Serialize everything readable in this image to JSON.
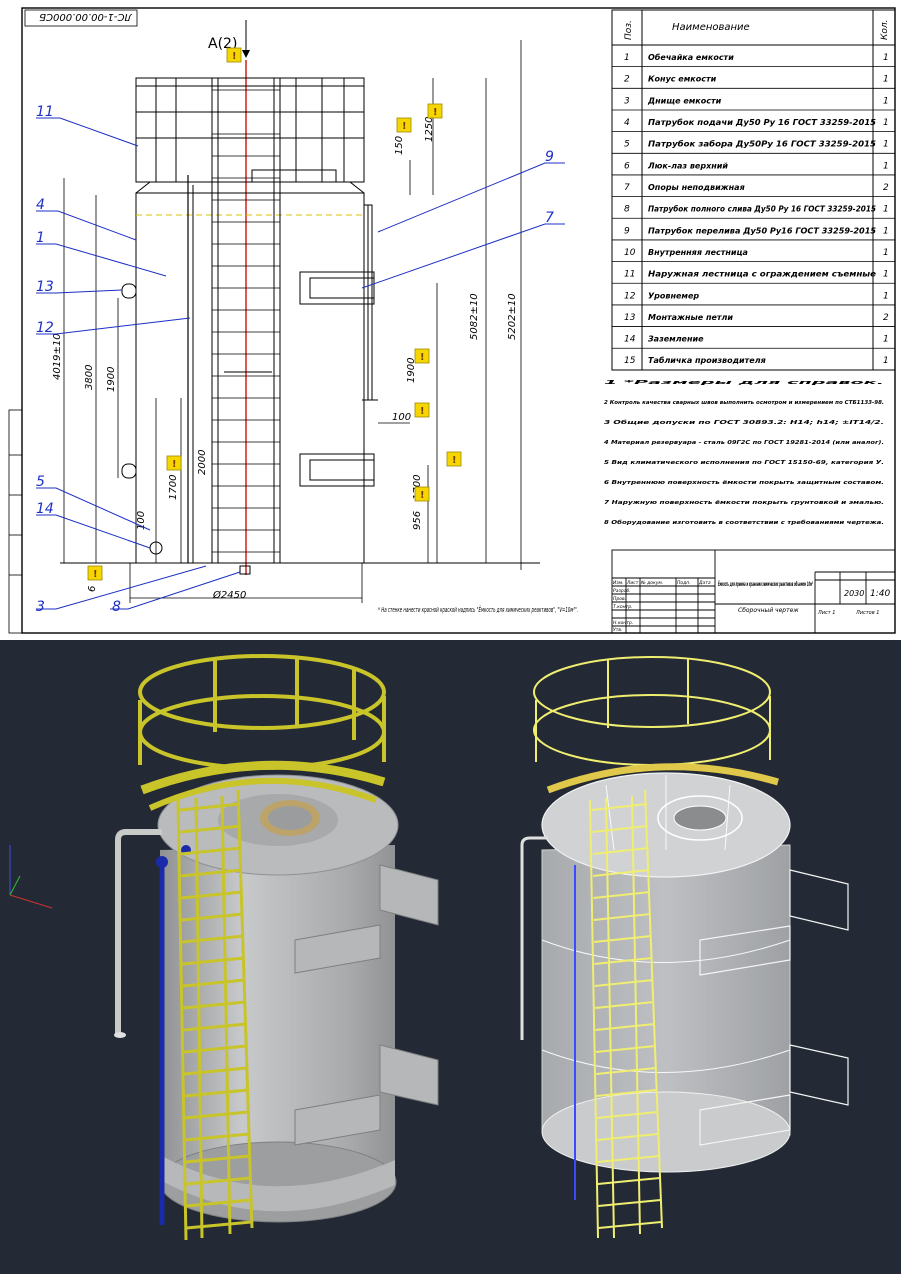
{
  "drawing": {
    "code": "ЛС-1-00.00.000СБ",
    "view_label": "А(2)",
    "dimensions": [
      "150",
      "1250",
      "5082±10",
      "5202±10",
      "4019±10",
      "3800",
      "1900",
      "1700",
      "2000",
      "100",
      "1900",
      "100",
      "1700",
      "956",
      "6",
      "Ø2450"
    ],
    "callouts": [
      "11",
      "4",
      "1",
      "13",
      "12",
      "5",
      "14",
      "3",
      "8",
      "9",
      "7"
    ],
    "footnote": "* На стенке нанести красной краской надпись \"Ёмкость для химических реактивов\", \"V=10м³\"."
  },
  "spec_table": {
    "headers": [
      "Поз.",
      "Наименование",
      "Кол."
    ],
    "rows": [
      {
        "pos": "1",
        "name": "Обечайка емкости",
        "qty": "1"
      },
      {
        "pos": "2",
        "name": "Конус емкости",
        "qty": "1"
      },
      {
        "pos": "3",
        "name": "Днище емкости",
        "qty": "1"
      },
      {
        "pos": "4",
        "name": "Патрубок подачи Ду50 Ру 16 ГОСТ 33259-2015",
        "qty": "1"
      },
      {
        "pos": "5",
        "name": "Патрубок забора Ду50Ру 16 ГОСТ 33259-2015",
        "qty": "1"
      },
      {
        "pos": "6",
        "name": "Люк-лаз верхний",
        "qty": "1"
      },
      {
        "pos": "7",
        "name": "Опоры неподвижная",
        "qty": "2"
      },
      {
        "pos": "8",
        "name": "Патрубок полного слива Ду50 Ру 16 ГОСТ 33259-2015",
        "qty": "1"
      },
      {
        "pos": "9",
        "name": "Патрубок перелива Ду50 Ру16 ГОСТ 33259-2015",
        "qty": "1"
      },
      {
        "pos": "10",
        "name": "Внутренняя лестница",
        "qty": "1"
      },
      {
        "pos": "11",
        "name": "Наружная лестница с ограждением съемные",
        "qty": "1"
      },
      {
        "pos": "12",
        "name": "Уровнемер",
        "qty": "1"
      },
      {
        "pos": "13",
        "name": "Монтажные петли",
        "qty": "2"
      },
      {
        "pos": "14",
        "name": "Заземление",
        "qty": "1"
      },
      {
        "pos": "15",
        "name": "Табличка производителя",
        "qty": "1"
      }
    ]
  },
  "notes": [
    "1 *Размеры для справок.",
    "2 Контроль качества сварных швов выполнить осмотром и измерением по СТБ1133-98.",
    "3 Общие допуски по ГОСТ 30893.2: H14; h14; ±IT14/2.",
    "4 Материал резервуара - сталь 09Г2С по ГОСТ 19281-2014 (или аналог).",
    "5 Вид климатического исполнения по ГОСТ 15150-69, категория У.",
    "6 Внутреннюю поверхность ёмкости покрыть защитным составом.",
    "7 Наружную поверхность ёмкости покрыть грунтовкой и эмалью.",
    "8 Оборудование изготовить в соответствии с требованиями чертежа."
  ],
  "title_block": {
    "name": "Ёмкость для приема и хранения химических реактивов объемом 10м³",
    "subtitle": "Сборочный чертеж",
    "mass": "2030",
    "scale": "1:40",
    "sheet": "Лист 1",
    "sheets": "Листов 1",
    "role_labels": [
      "Изм.",
      "Лист",
      "№ докум.",
      "Подп.",
      "Дата",
      "Разраб.",
      "Пров.",
      "Т.контр.",
      "Н.контр.",
      "Утв."
    ]
  },
  "warning_marker": "!",
  "colors": {
    "cad_background": "#232a35",
    "ladder_yellow": "#c8c42a",
    "tank_grey": "#a9abad",
    "pipe_blue": "#1a2aa8",
    "callout_blue": "#1c2fc4",
    "centerline_red": "#d01010",
    "marker_yellow": "#f5d600"
  }
}
